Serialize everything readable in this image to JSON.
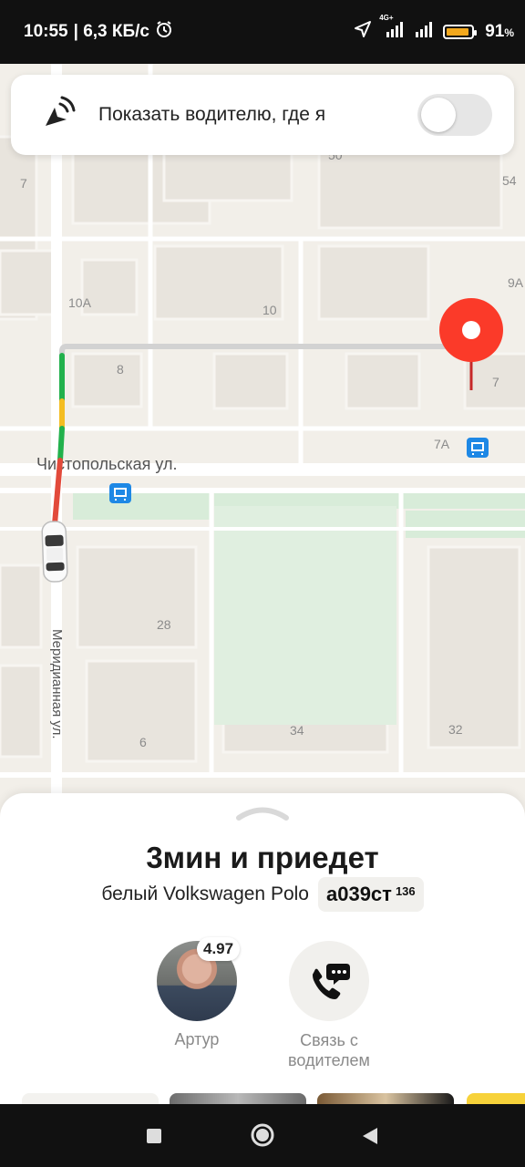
{
  "status_bar": {
    "time": "10:55",
    "speed": "| 6,3 КБ/с",
    "network": "4G+",
    "battery_percent": "91",
    "battery_level": 0.91,
    "battery_color": "#f2a81d"
  },
  "share_location": {
    "label": "Показать водителю, где я",
    "enabled": false
  },
  "map": {
    "street_names": {
      "chistopolskaya": "Чистопольская ул.",
      "meridiannaya": "Меридианная ул."
    },
    "house_numbers": {
      "n7_left": "7",
      "n50": "50",
      "n54": "54",
      "n10a": "10А",
      "n10": "10",
      "n9a": "9А",
      "n8": "8",
      "n7_right": "7",
      "n7a": "7А",
      "n28": "28",
      "n34": "34",
      "n32": "32",
      "n6": "6"
    },
    "route_colors": {
      "green": "#22b14c",
      "yellow": "#f4bd22",
      "red": "#e24a3b",
      "grey": "#d2d2d2"
    },
    "pin_color": "#fb3a29",
    "transit_color": "#1e88e5"
  },
  "ride": {
    "eta": "3мин и приедет",
    "car": "белый Volkswagen Polo",
    "plate_number": "а039ст",
    "plate_region": "136"
  },
  "driver": {
    "name": "Артур",
    "rating": "4.97"
  },
  "contact": {
    "label_line1": "Связь с",
    "label_line2": "водителем"
  }
}
